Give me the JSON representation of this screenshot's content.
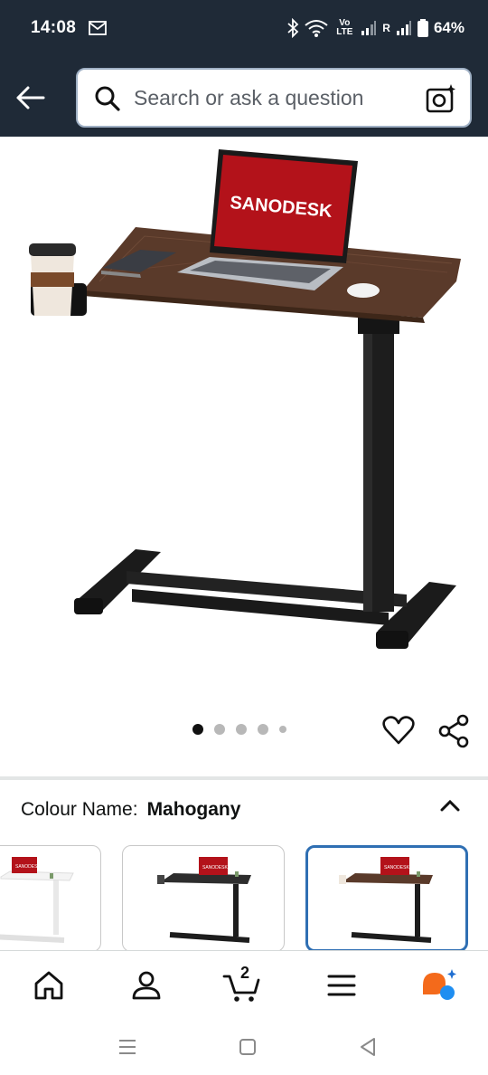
{
  "status_bar": {
    "time": "14:08",
    "network_label": "Vo LTE",
    "roaming": "R",
    "battery": "64%"
  },
  "header": {
    "search_placeholder": "Search or ask a question"
  },
  "product": {
    "brand_on_screen": "SANODESK",
    "image_count": 5,
    "active_image_index": 0
  },
  "variation": {
    "label": "Colour Name:",
    "value": "Mahogany",
    "options": [
      "White",
      "Black",
      "Mahogany"
    ],
    "selected_index": 2,
    "thumb_brand": "SANODESK"
  },
  "tab_bar": {
    "cart_count": "2",
    "items": [
      "home-icon",
      "account-icon",
      "cart-icon",
      "menu-icon",
      "rufus-icon"
    ]
  },
  "colors": {
    "header_bg": "#1f2a37",
    "accent_blue": "#2f6fb3",
    "desk_top": "#5a3a2a",
    "frame": "#1b1b1b",
    "laptop_screen": "#b3121a"
  }
}
